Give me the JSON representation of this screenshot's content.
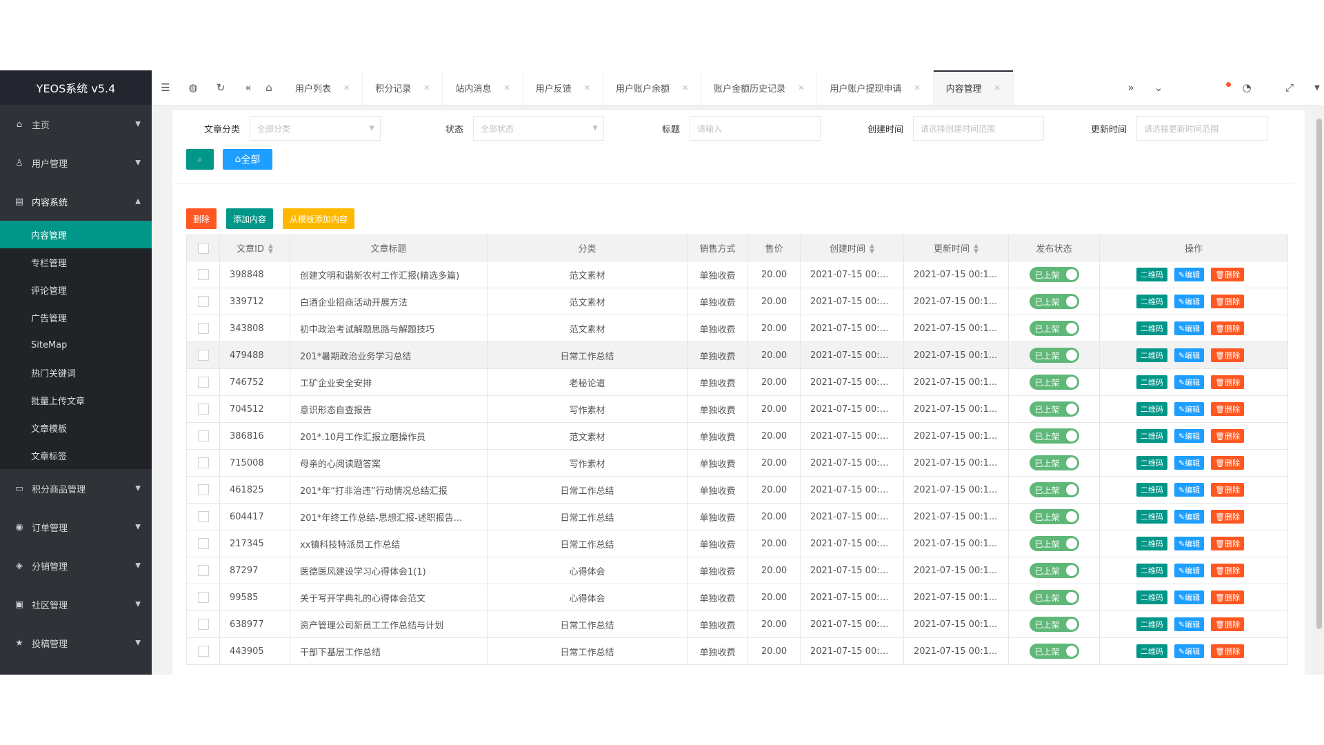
{
  "sidebar": {
    "logo": "YEOS系统 v5.4",
    "groups": [
      {
        "icon": "home-icon",
        "glyph": "⌂",
        "label": "主页"
      },
      {
        "icon": "user-icon",
        "glyph": "♙",
        "label": "用户管理"
      },
      {
        "icon": "content-icon",
        "glyph": "▤",
        "label": "内容系统"
      }
    ],
    "submenu": [
      "内容管理",
      "专栏管理",
      "评论管理",
      "广告管理",
      "SiteMap",
      "热门关键词",
      "批量上传文章",
      "文章模板",
      "文章标签"
    ],
    "groups_after": [
      {
        "icon": "goods-icon",
        "glyph": "▭",
        "label": "积分商品管理"
      },
      {
        "icon": "order-icon",
        "glyph": "◉",
        "label": "订单管理"
      },
      {
        "icon": "distribution-icon",
        "glyph": "◈",
        "label": "分销管理"
      },
      {
        "icon": "community-icon",
        "glyph": "▣",
        "label": "社区管理"
      },
      {
        "icon": "star-icon",
        "glyph": "★",
        "label": "投稿管理"
      }
    ]
  },
  "topbar": {
    "tabs": [
      "用户列表",
      "积分记录",
      "站内消息",
      "用户反馈",
      "用户账户余额",
      "账户金额历史记录",
      "用户账户提现申请",
      "内容管理"
    ],
    "active_tab": "内容管理",
    "close_glyph": "✕"
  },
  "filters": {
    "category_label": "文章分类",
    "category_value": "全部分类",
    "status_label": "状态",
    "status_value": "全部状态",
    "title_label": "标题",
    "title_placeholder": "请输入",
    "created_label": "创建时间",
    "created_placeholder": "请选择创建时间范围",
    "updated_label": "更新时间",
    "updated_placeholder": "请选择更新时间范围",
    "all_button": "全部"
  },
  "actions": {
    "delete": "删除",
    "add": "添加内容",
    "from_template": "从模板添加内容"
  },
  "table": {
    "headers": [
      "文章ID",
      "文章标题",
      "分类",
      "销售方式",
      "售价",
      "创建时间",
      "更新时间",
      "发布状态",
      "操作"
    ],
    "row_buttons": {
      "qr": "二维码",
      "edit": "编辑",
      "delete": "删除"
    },
    "rows": [
      {
        "id": "398848",
        "title": "创建文明和谐新农村工作汇报(精选多篇)",
        "category": "范文素材",
        "sale": "单独收费",
        "price": "20.00",
        "created": "2021-07-15 00:1...",
        "updated": "2021-07-15 00:1...",
        "status": "已上架"
      },
      {
        "id": "339712",
        "title": "白酒企业招商活动开展方法",
        "category": "范文素材",
        "sale": "单独收费",
        "price": "20.00",
        "created": "2021-07-15 00:1...",
        "updated": "2021-07-15 00:1...",
        "status": "已上架"
      },
      {
        "id": "343808",
        "title": "初中政治考试解题思路与解题技巧",
        "category": "范文素材",
        "sale": "单独收费",
        "price": "20.00",
        "created": "2021-07-15 00:1...",
        "updated": "2021-07-15 00:1...",
        "status": "已上架"
      },
      {
        "id": "479488",
        "title": "201*暑期政治业务学习总结",
        "category": "日常工作总结",
        "sale": "单独收费",
        "price": "20.00",
        "created": "2021-07-15 00:1...",
        "updated": "2021-07-15 00:1...",
        "status": "已上架"
      },
      {
        "id": "746752",
        "title": "工矿企业安全安排",
        "category": "老秘论道",
        "sale": "单独收费",
        "price": "20.00",
        "created": "2021-07-15 00:1...",
        "updated": "2021-07-15 00:1...",
        "status": "已上架"
      },
      {
        "id": "704512",
        "title": "意识形态自查报告",
        "category": "写作素材",
        "sale": "单独收费",
        "price": "20.00",
        "created": "2021-07-15 00:1...",
        "updated": "2021-07-15 00:1...",
        "status": "已上架"
      },
      {
        "id": "386816",
        "title": "201*.10月工作汇报立磨操作员",
        "category": "范文素材",
        "sale": "单独收费",
        "price": "20.00",
        "created": "2021-07-15 00:1...",
        "updated": "2021-07-15 00:1...",
        "status": "已上架"
      },
      {
        "id": "715008",
        "title": "母亲的心阅读题答案",
        "category": "写作素材",
        "sale": "单独收费",
        "price": "20.00",
        "created": "2021-07-15 00:1...",
        "updated": "2021-07-15 00:1...",
        "status": "已上架"
      },
      {
        "id": "461825",
        "title": "201*年“打非治违”行动情况总结汇报",
        "category": "日常工作总结",
        "sale": "单独收费",
        "price": "20.00",
        "created": "2021-07-15 00:1...",
        "updated": "2021-07-15 00:1...",
        "status": "已上架"
      },
      {
        "id": "604417",
        "title": "201*年终工作总结-思想汇报-述职报告...",
        "category": "日常工作总结",
        "sale": "单独收费",
        "price": "20.00",
        "created": "2021-07-15 00:1...",
        "updated": "2021-07-15 00:1...",
        "status": "已上架"
      },
      {
        "id": "217345",
        "title": "xx镇科技特派员工作总结",
        "category": "日常工作总结",
        "sale": "单独收费",
        "price": "20.00",
        "created": "2021-07-15 00:1...",
        "updated": "2021-07-15 00:1...",
        "status": "已上架"
      },
      {
        "id": "87297",
        "title": "医德医风建设学习心得体会1(1)",
        "category": "心得体会",
        "sale": "单独收费",
        "price": "20.00",
        "created": "2021-07-15 00:1...",
        "updated": "2021-07-15 00:1...",
        "status": "已上架"
      },
      {
        "id": "99585",
        "title": "关于写开学典礼的心得体会范文",
        "category": "心得体会",
        "sale": "单独收费",
        "price": "20.00",
        "created": "2021-07-15 00:1...",
        "updated": "2021-07-15 00:1...",
        "status": "已上架"
      },
      {
        "id": "638977",
        "title": "资产管理公司新员工工作总结与计划",
        "category": "日常工作总结",
        "sale": "单独收费",
        "price": "20.00",
        "created": "2021-07-15 00:1...",
        "updated": "2021-07-15 00:1...",
        "status": "已上架"
      },
      {
        "id": "443905",
        "title": "干部下基层工作总结",
        "category": "日常工作总结",
        "sale": "单独收费",
        "price": "20.00",
        "created": "2021-07-15 00:1...",
        "updated": "2021-07-15 00:1...",
        "status": "已上架"
      }
    ]
  },
  "colors": {
    "sidebar_bg": "#2f3237",
    "accent": "#009688",
    "blue": "#1e9fff",
    "danger": "#ff5722",
    "warn": "#ffb800",
    "switch_on": "#5fb878"
  }
}
